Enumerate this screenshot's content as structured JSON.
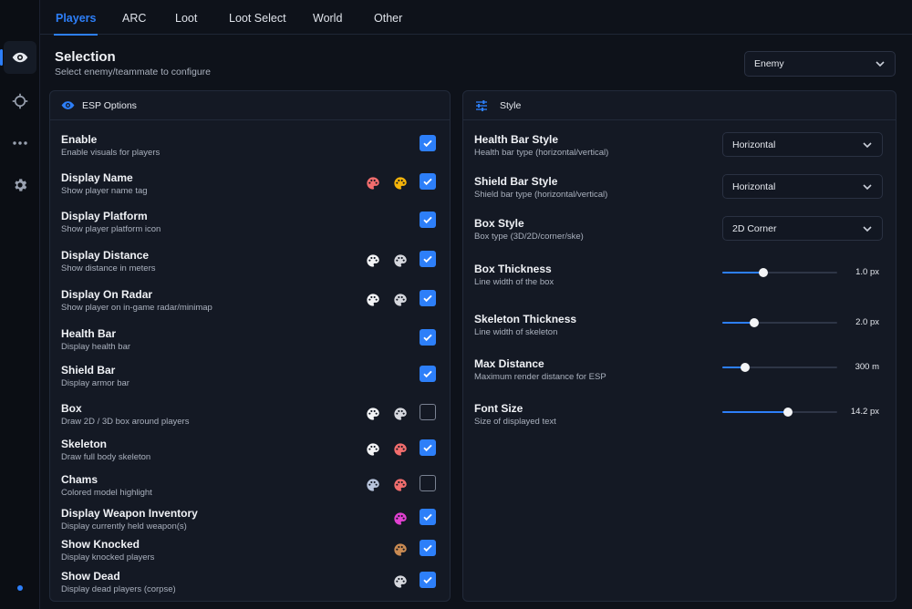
{
  "sidebar": {
    "items": [
      {
        "icon": "eye-icon",
        "active": true
      },
      {
        "icon": "crosshair-icon",
        "active": false
      },
      {
        "icon": "more-icon",
        "active": false
      },
      {
        "icon": "gear-icon",
        "active": false
      }
    ]
  },
  "tabs": [
    "Players",
    "ARC",
    "Loot",
    "Loot Select",
    "World",
    "Other"
  ],
  "selection": {
    "title": "Selection",
    "subtitle": "Select enemy/teammate to configure",
    "value": "Enemy"
  },
  "esp": {
    "title": "ESP Options",
    "rows": [
      {
        "label": "Enable",
        "desc": "Enable visuals for players",
        "checked": true,
        "palettes": []
      },
      {
        "label": "Display Name",
        "desc": "Show player name tag",
        "checked": true,
        "palettes": [
          "#f26d6d",
          "#f5b40a"
        ]
      },
      {
        "label": "Display Platform",
        "desc": "Show player platform icon",
        "checked": true,
        "palettes": []
      },
      {
        "label": "Display Distance",
        "desc": "Show distance in meters",
        "checked": true,
        "palettes": [
          "#f3f4f6",
          "#d6d8de"
        ]
      },
      {
        "label": "Display On Radar",
        "desc": "Show player on in-game radar/minimap",
        "checked": true,
        "palettes": [
          "#f3f4f6",
          "#d6d8de"
        ]
      },
      {
        "label": "Health Bar",
        "desc": "Display health bar",
        "checked": true,
        "palettes": []
      },
      {
        "label": "Shield Bar",
        "desc": "Display armor bar",
        "checked": true,
        "palettes": []
      },
      {
        "label": "Box",
        "desc": "Draw 2D / 3D box around players",
        "checked": false,
        "palettes": [
          "#f3f4f6",
          "#d6d8de"
        ]
      },
      {
        "label": "Skeleton",
        "desc": "Draw full body skeleton",
        "checked": true,
        "palettes": [
          "#f3f4f6",
          "#f26d6d"
        ]
      },
      {
        "label": "Chams",
        "desc": "Colored model highlight",
        "checked": false,
        "palettes": [
          "#b8c4dc",
          "#f26d6d"
        ]
      },
      {
        "label": "Display Weapon Inventory",
        "desc": "Display currently held weapon(s)",
        "checked": true,
        "palettes": [
          "#e040d0"
        ]
      },
      {
        "label": "Show Knocked",
        "desc": "Display knocked players",
        "checked": true,
        "palettes": [
          "#c98a52"
        ]
      },
      {
        "label": "Show Dead",
        "desc": "Display dead players (corpse)",
        "checked": true,
        "palettes": [
          "#d6d8de"
        ]
      }
    ]
  },
  "style": {
    "title": "Style",
    "dropdowns": [
      {
        "label": "Health Bar Style",
        "desc": "Health bar type (horizontal/vertical)",
        "value": "Horizontal"
      },
      {
        "label": "Shield Bar Style",
        "desc": "Shield bar type (horizontal/vertical)",
        "value": "Horizontal"
      },
      {
        "label": "Box Style",
        "desc": "Box type (3D/2D/corner/ske)",
        "value": "2D Corner"
      }
    ],
    "sliders": [
      {
        "label": "Box Thickness",
        "desc": "Line width of the box",
        "value": "1.0 px",
        "fraction": 0.36
      },
      {
        "label": "Skeleton Thickness",
        "desc": "Line width of skeleton",
        "value": "2.0 px",
        "fraction": 0.28
      },
      {
        "label": "Max Distance",
        "desc": "Maximum render distance for ESP",
        "value": "300 m",
        "fraction": 0.2
      },
      {
        "label": "Font Size",
        "desc": "Size of displayed text",
        "value": "14.2 px",
        "fraction": 0.57
      }
    ]
  },
  "colors": {
    "accent": "#2d7ff9"
  }
}
